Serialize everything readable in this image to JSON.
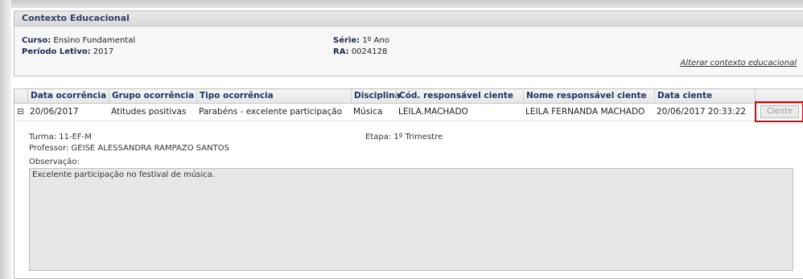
{
  "context": {
    "title": "Contexto Educacional",
    "curso_label": "Curso:",
    "curso_value": "Ensino Fundamental",
    "periodo_label": "Período Letivo:",
    "periodo_value": "2017",
    "serie_label": "Série:",
    "serie_value": "1º Ano",
    "ra_label": "RA:",
    "ra_value": "0024128",
    "alter_link": "Alterar contexto educacional"
  },
  "grid": {
    "columns": [
      "Data ocorrência",
      "Grupo ocorrência",
      "Tipo ocorrência",
      "Disciplina",
      "Cód. responsável ciente",
      "Nome responsável ciente",
      "Data ciente"
    ],
    "row": {
      "data": "20/06/2017",
      "grupo": "Atitudes positivas",
      "tipo": "Parabéns - excelente participação",
      "disciplina": "Música",
      "cod": "LEILA.MACHADO",
      "nome": "LEILA FERNANDA MACHADO",
      "data_ciente": "20/06/2017 20:33:22",
      "button_label": "Ciente"
    },
    "highlight_color": "#e00000"
  },
  "detail": {
    "turma": "Turma: 11-EF-M",
    "etapa": "Etapa: 1º Trimestre",
    "professor": "Professor: GEISE ALESSANDRA RAMPAZO SANTOS",
    "obs_label": "Observação:",
    "obs_text": "Excelente participação no festival de música."
  }
}
